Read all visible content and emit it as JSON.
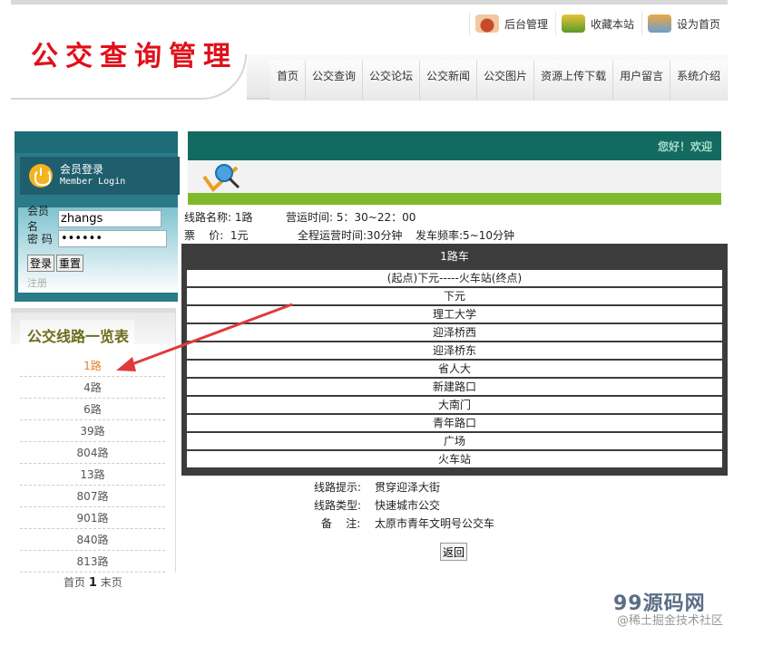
{
  "header": {
    "logo_text": "公交查询管理",
    "top_links": [
      {
        "label": "后台管理",
        "icon": "phone-icon"
      },
      {
        "label": "收藏本站",
        "icon": "bookmark-icon"
      },
      {
        "label": "设为首页",
        "icon": "home-icon"
      }
    ],
    "nav": [
      "首页",
      "公交查询",
      "公交论坛",
      "公交新闻",
      "公交图片",
      "资源上传下载",
      "用户留言",
      "系统介绍"
    ]
  },
  "login": {
    "title": "会员登录",
    "subtitle": "Member Login",
    "username_label": "会员名",
    "username_value": "zhangs",
    "password_label": "密  码",
    "password_value": "••••••",
    "login_button": "登录",
    "reset_button": "重置",
    "register_link": "注册"
  },
  "routes": {
    "title": "公交线路一览表",
    "items": [
      "1路",
      "4路",
      "6路",
      "39路",
      "804路",
      "13路",
      "807路",
      "901路",
      "840路",
      "813路"
    ],
    "active_index": 0,
    "pager_first": "首页",
    "pager_current": "1",
    "pager_last": "末页"
  },
  "main": {
    "greeting": "您好！欢迎",
    "route_name": "线路名称: 1路",
    "operating_time": "营运时间: 5：30~22：00",
    "fare": "票    价:  1元",
    "full_time": "全程运营时间:30分钟",
    "frequency": "发车频率:5~10分钟",
    "table_caption": "1路车",
    "stops": [
      "(起点)下元-----火车站(终点)",
      "下元",
      "理工大学",
      "迎泽桥西",
      "迎泽桥东",
      "省人大",
      "新建路口",
      "大南门",
      "青年路口",
      "广场",
      "火车站"
    ],
    "hint_label": "线路提示:",
    "hint_value": "贯穿迎泽大街",
    "type_label": "线路类型:",
    "type_value": "快速城市公交",
    "note_label": "备    注:",
    "note_value": "太原市青年文明号公交车",
    "back_button": "返回"
  },
  "watermark": {
    "brand": "99源码网",
    "sub": "@稀土掘金技术社区"
  },
  "colors": {
    "logo": "#e0101a",
    "header_teal": "#136a60",
    "green_bar": "#7fba2a",
    "active_route": "#e67e22",
    "arrow": "#e03b3b"
  }
}
